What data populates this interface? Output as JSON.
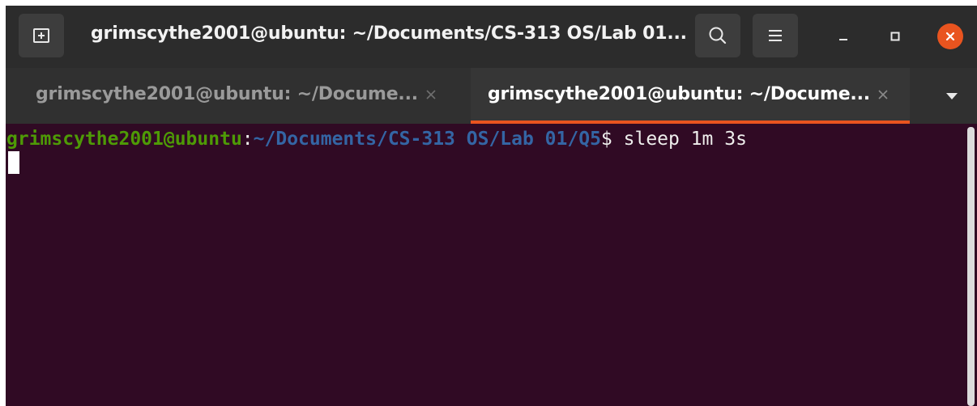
{
  "window": {
    "title": "grimscythe2001@ubuntu: ~/Documents/CS-313 OS/Lab 01...",
    "new_tab_icon": "new-tab-icon",
    "search_icon": "search-icon",
    "menu_icon": "hamburger-menu-icon",
    "minimize_label": "–",
    "maximize_icon": "maximize-icon",
    "close_icon": "close-icon",
    "close_color": "#e9541f"
  },
  "tabs": [
    {
      "label": "grimscythe2001@ubuntu: ~/Docume...",
      "active": false
    },
    {
      "label": "grimscythe2001@ubuntu: ~/Docume...",
      "active": true
    }
  ],
  "tab_overflow_icon": "chevron-down-icon",
  "terminal": {
    "prompt_user": "grimscythe2001@ubuntu",
    "prompt_colon": ":",
    "prompt_path": "~/Documents/CS-313 OS/Lab 01/Q5",
    "prompt_symbol": "$",
    "command": " sleep 1m 3s",
    "background": "#300a24",
    "user_color": "#4e9a06",
    "path_color": "#3465a4"
  }
}
